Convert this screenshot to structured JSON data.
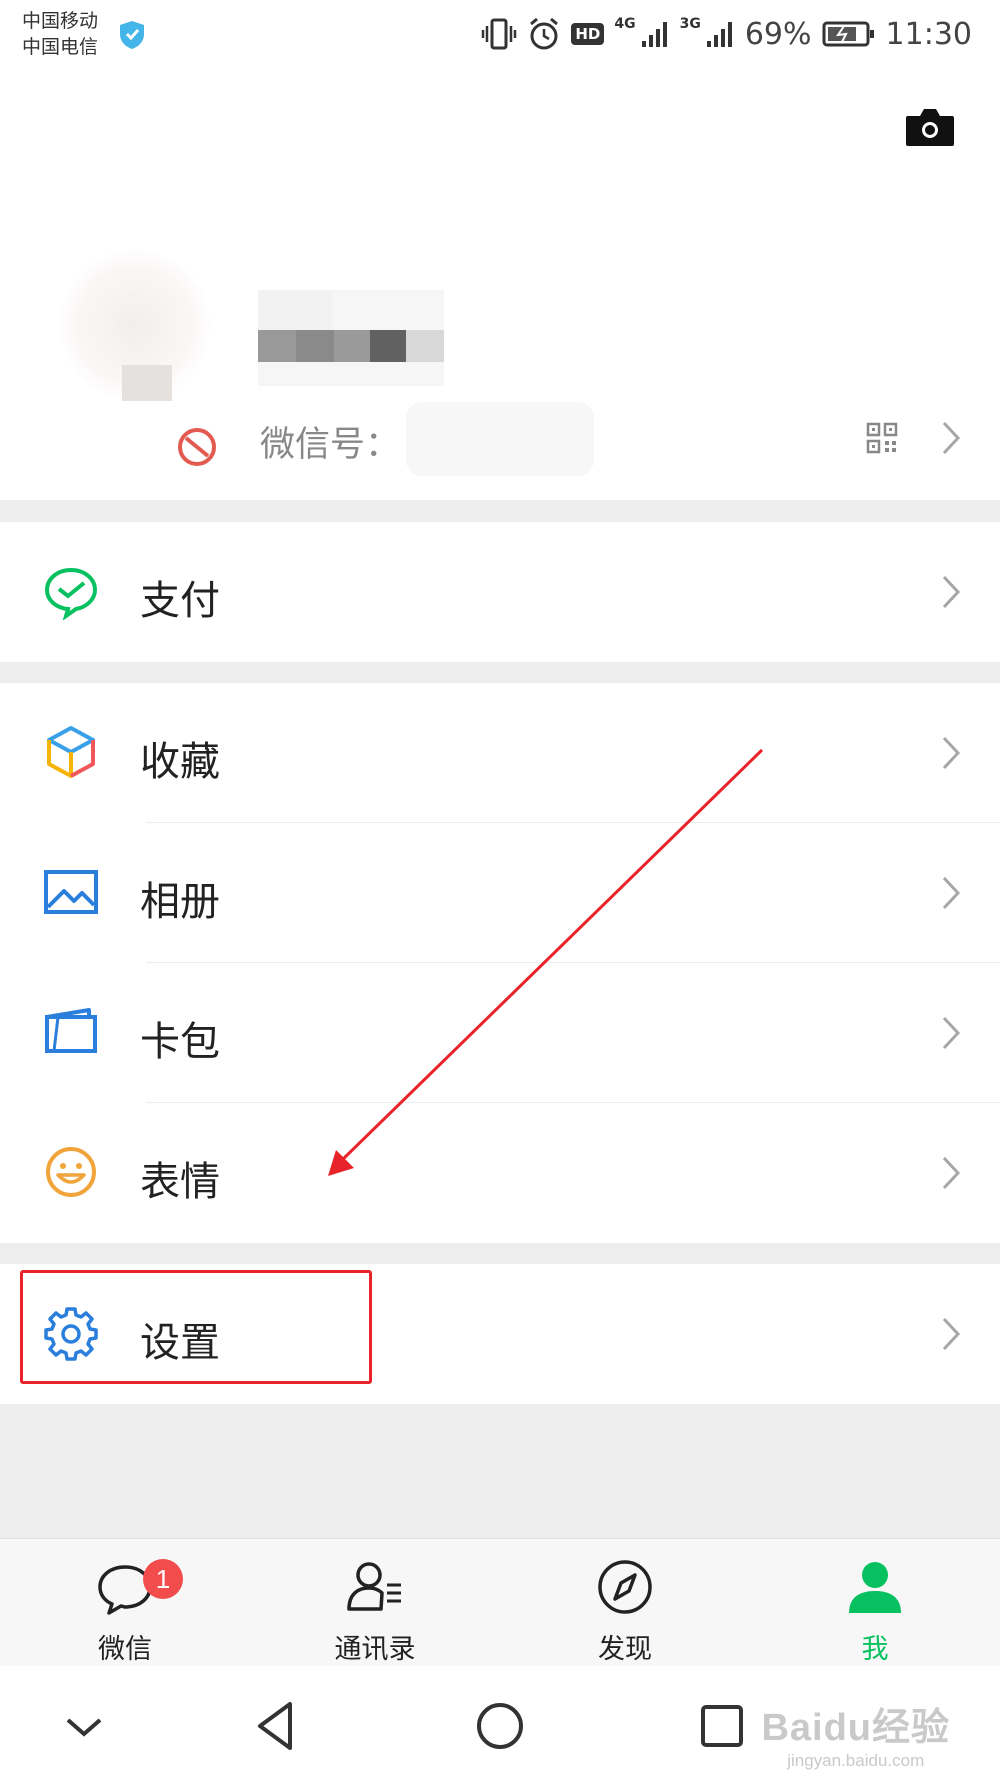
{
  "status_bar": {
    "carrier_1": "中国移动",
    "carrier_2": "中国电信",
    "network_1": "4G",
    "network_2": "3G",
    "hd_label": "HD",
    "battery_percent": "69%",
    "time": "11:30"
  },
  "profile": {
    "wechat_id_label": "微信号：",
    "icons": [
      "camera-icon",
      "blocked-icon",
      "qr-code-icon",
      "chevron-right-icon"
    ]
  },
  "menu": {
    "pay": {
      "label": "支付",
      "icon": "wechat-pay-icon",
      "color": "#07c160"
    },
    "favorites": {
      "label": "收藏",
      "icon": "cube-icon"
    },
    "album": {
      "label": "相册",
      "icon": "photo-icon",
      "color": "#2b7fdc"
    },
    "cards": {
      "label": "卡包",
      "icon": "card-wallet-icon",
      "color": "#2b7fdc"
    },
    "stickers": {
      "label": "表情",
      "icon": "smiley-icon",
      "color": "#f0a43a"
    },
    "settings": {
      "label": "设置",
      "icon": "gear-icon",
      "color": "#2b7fdc"
    }
  },
  "tabs": [
    {
      "label": "微信",
      "icon": "chat-bubble-icon",
      "badge": "1"
    },
    {
      "label": "通讯录",
      "icon": "contacts-icon"
    },
    {
      "label": "发现",
      "icon": "compass-icon"
    },
    {
      "label": "我",
      "icon": "person-icon",
      "active": true,
      "color": "#07c160"
    }
  ],
  "watermark": {
    "line1": "Baidu经验",
    "line2": "jingyan.baidu.com"
  },
  "annotation": {
    "color": "#e8242a"
  }
}
